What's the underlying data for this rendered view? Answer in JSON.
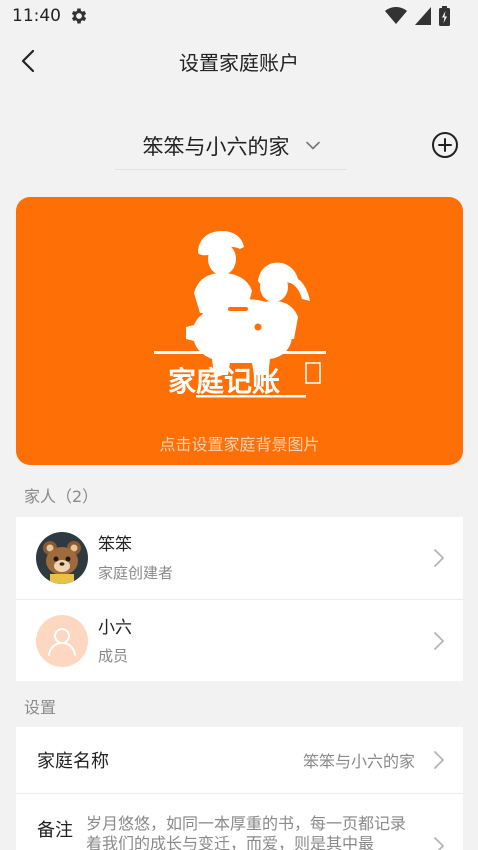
{
  "status_bar": {
    "time": "11:40",
    "icons": [
      "settings-gear-icon",
      "wifi-icon",
      "cell-signal-icon",
      "battery-charging-icon"
    ]
  },
  "nav": {
    "title": "设置家庭账户",
    "back_icon": "back-chevron-icon"
  },
  "family_selector": {
    "selected": "笨笨与小六的家",
    "dropdown_icon": "chevron-down-icon",
    "add_icon": "add-circle-icon"
  },
  "banner": {
    "logo_text": "家庭记账",
    "hint": "点击设置家庭背景图片",
    "background_color": "#fe6f06"
  },
  "members_section": {
    "title": "家人（2）",
    "members": [
      {
        "name": "笨笨",
        "role": "家庭创建者",
        "avatar": "bear-avatar"
      },
      {
        "name": "小六",
        "role": "成员",
        "avatar": "default-person-avatar"
      }
    ]
  },
  "settings_section": {
    "title": "设置",
    "family_name_label": "家庭名称",
    "family_name_value": "笨笨与小六的家",
    "note_label": "备注",
    "note_text": "岁月悠悠，如同一本厚重的书，每一页都记录着我们的成长与变迁，而爱，则是其中最"
  }
}
